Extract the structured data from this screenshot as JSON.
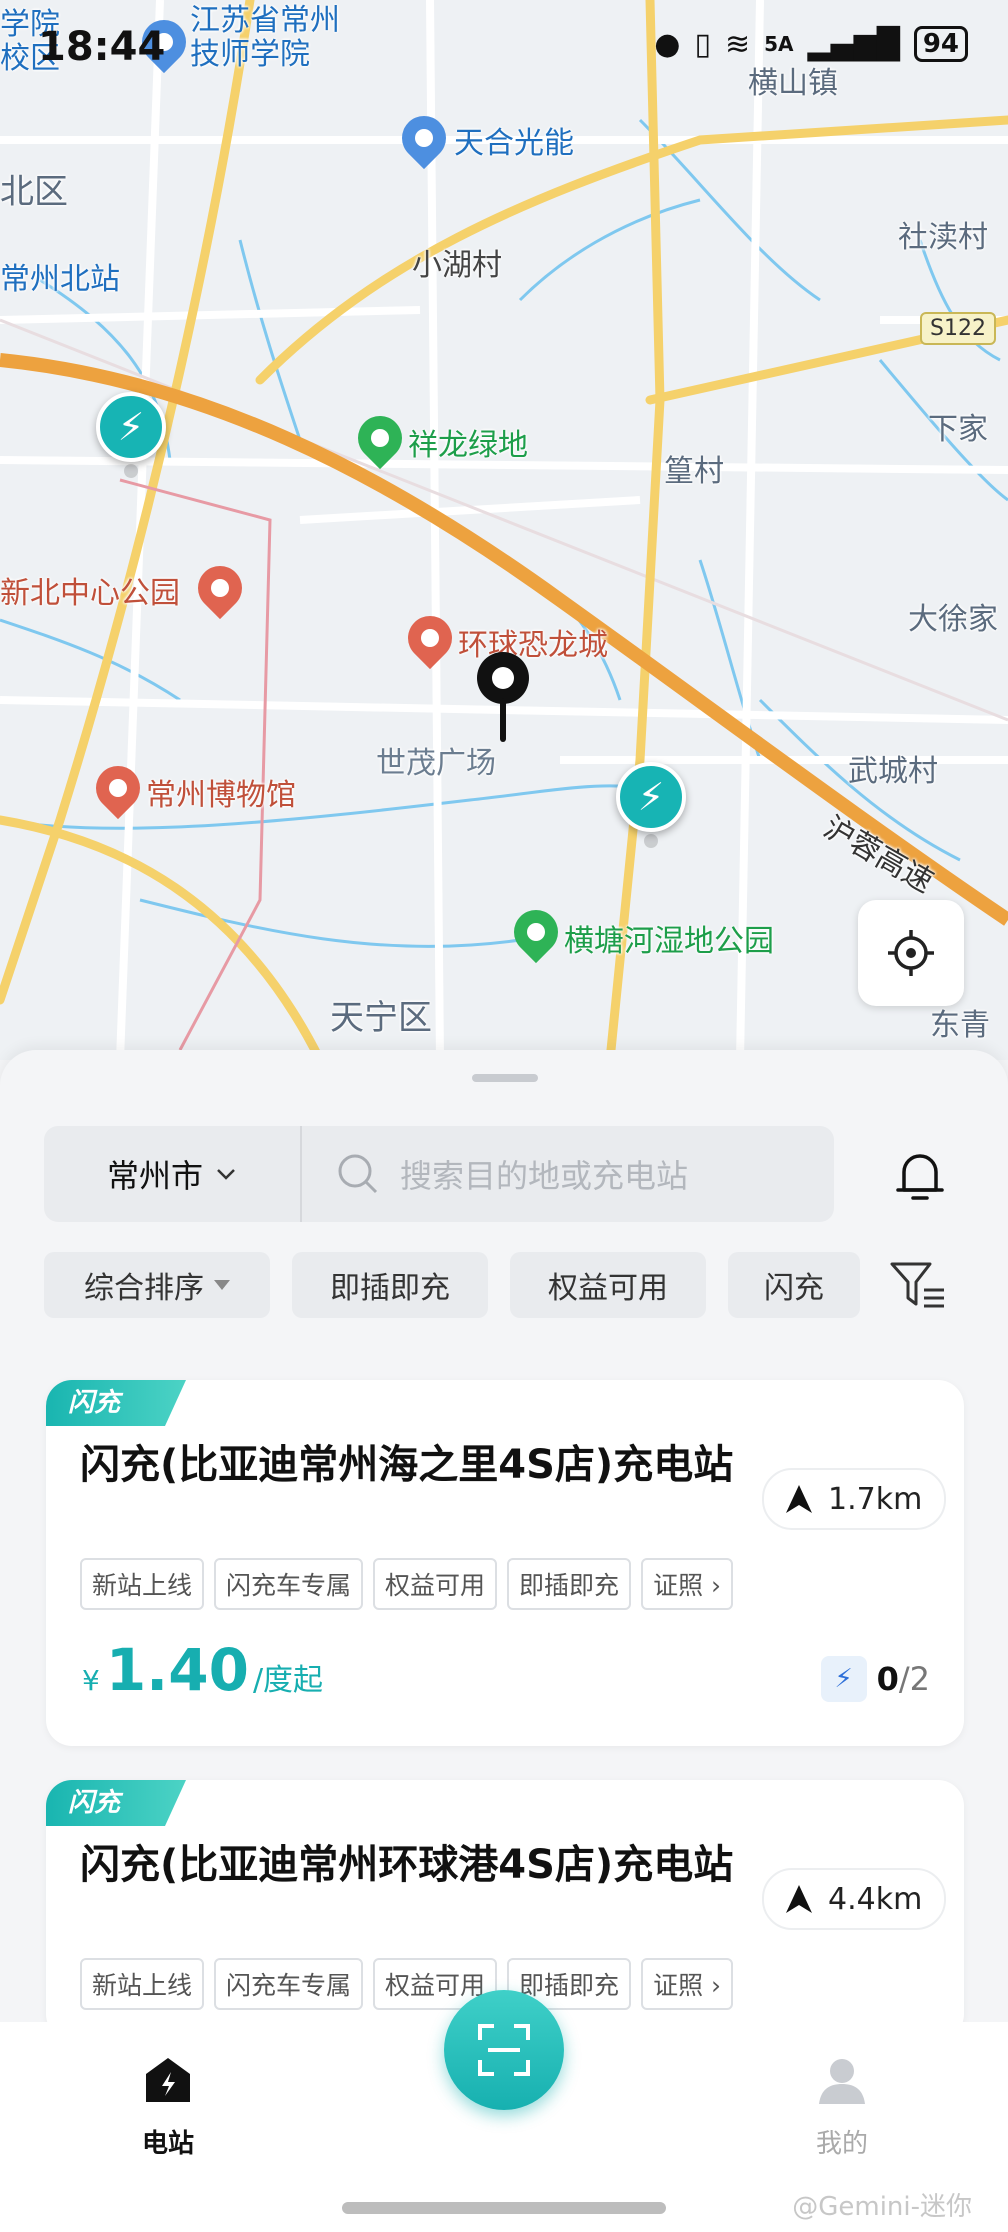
{
  "status_bar": {
    "time": "18:44",
    "network": "5A",
    "battery": "94"
  },
  "map": {
    "labels": {
      "jiangsu_college": "江苏省常州\n技师学院",
      "school_fragment": "学院\n校区",
      "tianhe": "天合光能",
      "beiqu": "北区",
      "xiaohu": "小湖村",
      "changzhou_north": "常州北站",
      "hengshan": "横山镇",
      "shedu": "社渎村",
      "xiajia": "下家",
      "xianglong": "祥龙绿地",
      "huangcun": "篁村",
      "xinbei_park": "新北中心公园",
      "dinosaur": "环球恐龙城",
      "daxujia": "大徐家",
      "shimao": "世茂广场",
      "wucheng": "武城村",
      "museum": "常州博物馆",
      "huyu": "沪蓉高速",
      "hengtang": "横塘河湿地公园",
      "tianning": "天宁区",
      "dongqing": "东青"
    },
    "route_badge": "S122"
  },
  "search": {
    "city": "常州市",
    "placeholder": "搜索目的地或充电站"
  },
  "filters": [
    "综合排序",
    "即插即充",
    "权益可用",
    "闪充"
  ],
  "stations": [
    {
      "tag": "闪充",
      "name": "闪充(比亚迪常州海之里4S店)充电站",
      "distance": "1.7km",
      "badges": [
        "新站上线",
        "闪充车专属",
        "权益可用",
        "即插即充",
        "证照 ›"
      ],
      "currency": "¥",
      "price": "1.40",
      "price_unit": "/度起",
      "ports_available": "0",
      "ports_total": "/2"
    },
    {
      "tag": "闪充",
      "name": "闪充(比亚迪常州环球港4S店)充电站",
      "distance": "4.4km",
      "badges": [
        "新站上线",
        "闪充车专属",
        "权益可用",
        "即插即充",
        "证照 ›"
      ],
      "currency": "¥",
      "price": "",
      "price_unit": "",
      "ports_available": "",
      "ports_total": ""
    }
  ],
  "tabs": {
    "stations": "电站",
    "mine": "我的"
  },
  "watermark": "@Gemini-迷你",
  "colors": {
    "accent": "#17b4b4",
    "price": "#17aeb0"
  }
}
